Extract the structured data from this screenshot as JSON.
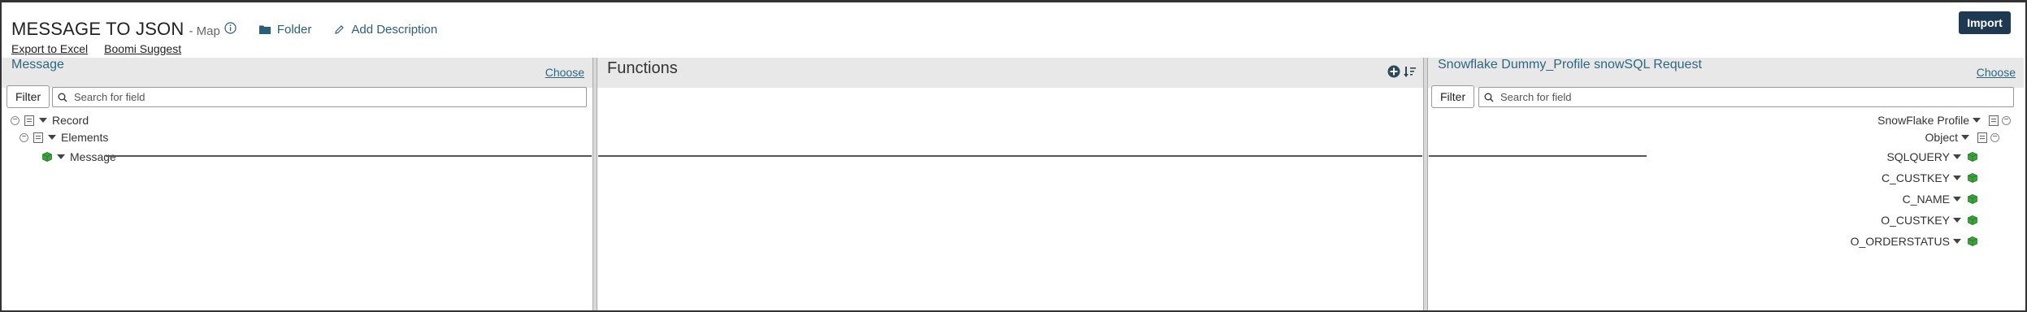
{
  "header": {
    "title": "MESSAGE TO JSON",
    "subtitle": "- Map",
    "folder_label": "Folder",
    "add_description_label": "Add Description",
    "import_label": "Import"
  },
  "sublinks": {
    "export_excel": "Export to Excel",
    "boomi_suggest": "Boomi Suggest"
  },
  "source_panel": {
    "title": "Message",
    "choose_label": "Choose",
    "filter_label": "Filter",
    "search_placeholder": "Search for field",
    "tree": [
      {
        "label": "Record"
      },
      {
        "label": "Elements"
      },
      {
        "label": "Message"
      }
    ]
  },
  "functions_panel": {
    "title": "Functions"
  },
  "target_panel": {
    "title": "Snowflake Dummy_Profile snowSQL Request",
    "choose_label": "Choose",
    "filter_label": "Filter",
    "search_placeholder": "Search for field",
    "tree": [
      {
        "label": "SnowFlake Profile"
      },
      {
        "label": "Object"
      },
      {
        "label": "SQLQUERY"
      },
      {
        "label": "C_CUSTKEY"
      },
      {
        "label": "C_NAME"
      },
      {
        "label": "O_CUSTKEY"
      },
      {
        "label": "O_ORDERSTATUS"
      }
    ]
  },
  "colors": {
    "accent": "#2a6a80",
    "import_bg": "#1e3a52",
    "panel_header_bg": "#e8e8e8",
    "leaf_green": "#3aa537"
  }
}
